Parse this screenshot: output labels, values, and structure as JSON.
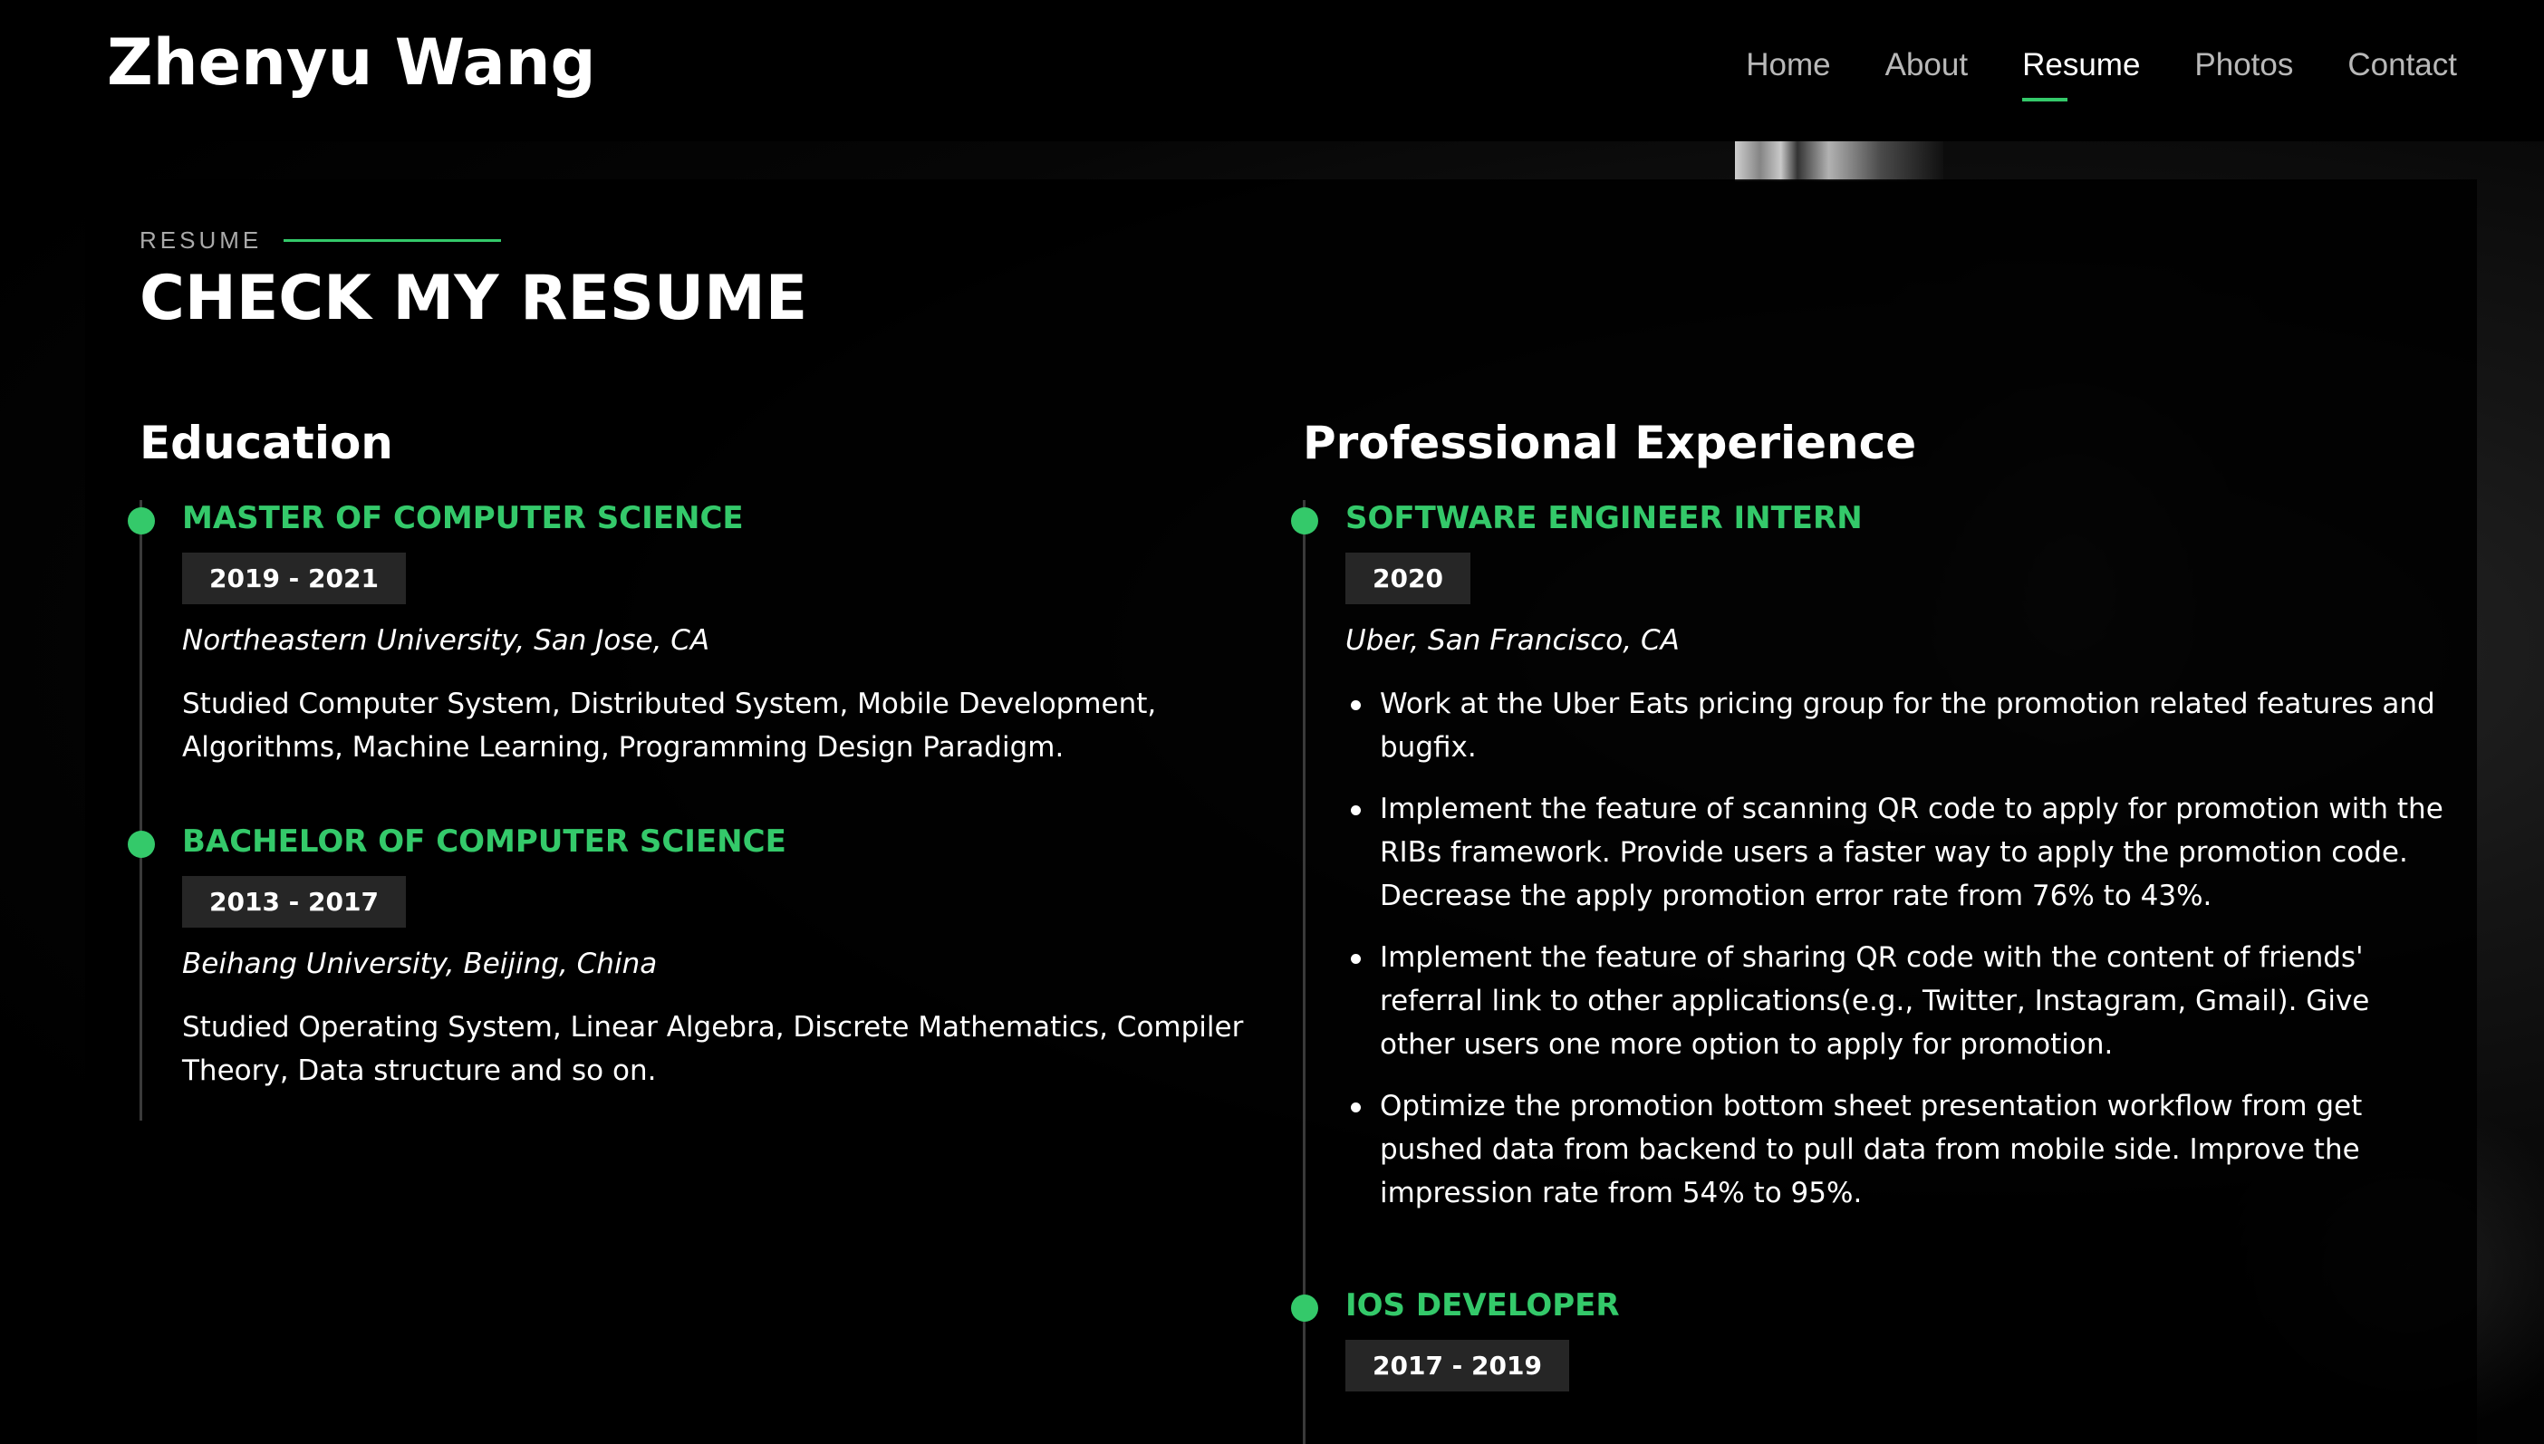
{
  "header": {
    "logo": "Zhenyu Wang",
    "nav": [
      {
        "label": "Home",
        "active": false
      },
      {
        "label": "About",
        "active": false
      },
      {
        "label": "Resume",
        "active": true
      },
      {
        "label": "Photos",
        "active": false
      },
      {
        "label": "Contact",
        "active": false
      }
    ]
  },
  "resume": {
    "label": "RESUME",
    "title": "CHECK MY RESUME",
    "education": {
      "title": "Education",
      "items": [
        {
          "title": "MASTER OF COMPUTER SCIENCE",
          "date": "2019 - 2021",
          "place": "Northeastern University, San Jose, CA",
          "desc": "Studied Computer System, Distributed System, Mobile Development, Algorithms, Machine Learning, Programming Design Paradigm."
        },
        {
          "title": "BACHELOR OF COMPUTER SCIENCE",
          "date": "2013 - 2017",
          "place": "Beihang University, Beijing, China",
          "desc": "Studied Operating System, Linear Algebra, Discrete Mathematics, Compiler Theory, Data structure and so on."
        }
      ]
    },
    "experience": {
      "title": "Professional Experience",
      "items": [
        {
          "title": "SOFTWARE ENGINEER INTERN",
          "date": "2020",
          "place": "Uber, San Francisco, CA",
          "bullets": [
            "Work at the Uber Eats pricing group for the promotion related features and bugfix.",
            "Implement the feature of scanning QR code to apply for promotion with the RIBs framework. Provide users a faster way to apply the promotion code. Decrease the apply promotion error rate from 76% to 43%.",
            "Implement the feature of sharing QR code with the content of friends' referral link to other applications(e.g., Twitter, Instagram, Gmail). Give other users one more option to apply for promotion.",
            "Optimize the promotion bottom sheet presentation workflow from get pushed data from backend to pull data from mobile side. Improve the impression rate from 54% to 95%."
          ]
        },
        {
          "title": "IOS DEVELOPER",
          "date": "2017 - 2019"
        }
      ]
    }
  },
  "colors": {
    "accent": "#34c96a",
    "date_bg": "#262626",
    "background": "#000000"
  }
}
